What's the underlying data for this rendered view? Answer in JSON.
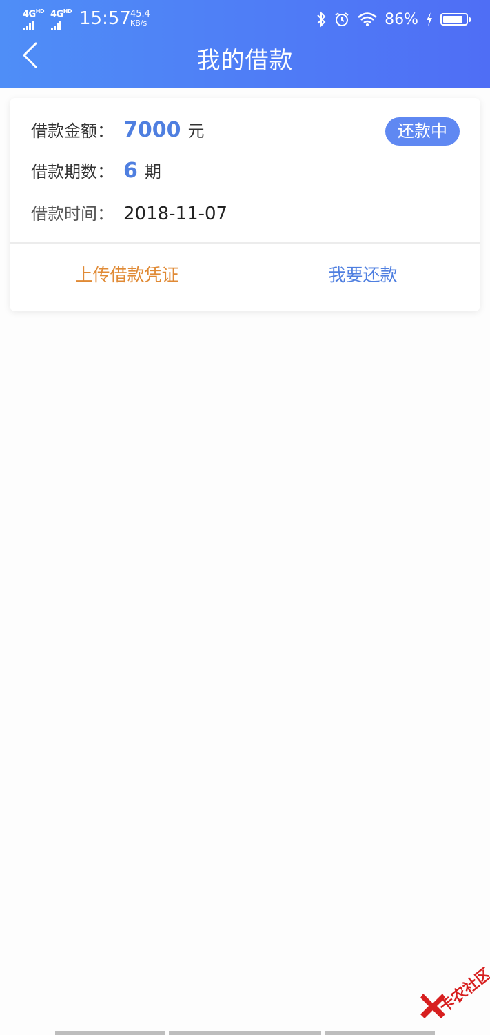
{
  "status_bar": {
    "network_1": "4G",
    "network_1_sup": "HD",
    "network_2": "4G",
    "network_2_sup": "HD",
    "time": "15:57",
    "speed_value": "45.4",
    "speed_unit": "KB/s",
    "battery": "86%",
    "battery_level": 0.86,
    "icons": [
      "bluetooth-icon",
      "alarm-icon",
      "wifi-icon",
      "charging-icon",
      "battery-icon"
    ]
  },
  "header": {
    "title": "我的借款",
    "back_icon": "chevron-left-icon"
  },
  "loan_card": {
    "amount_label": "借款金额：",
    "amount_value": "7000",
    "amount_unit": "元",
    "periods_label": "借款期数：",
    "periods_value": "6",
    "periods_unit": "期",
    "time_label": "借款时间：",
    "time_value": "2018-11-07",
    "status_badge": "还款中",
    "upload_button": "上传借款凭证",
    "repay_button": "我要还款"
  },
  "watermark": {
    "text": "卡农社区"
  },
  "colors": {
    "header_gradient_start": "#4f8ef7",
    "header_gradient_end": "#4f6ef5",
    "accent_blue": "#4f7fe0",
    "badge_blue": "#5f88f2",
    "action_orange": "#e08a35"
  }
}
